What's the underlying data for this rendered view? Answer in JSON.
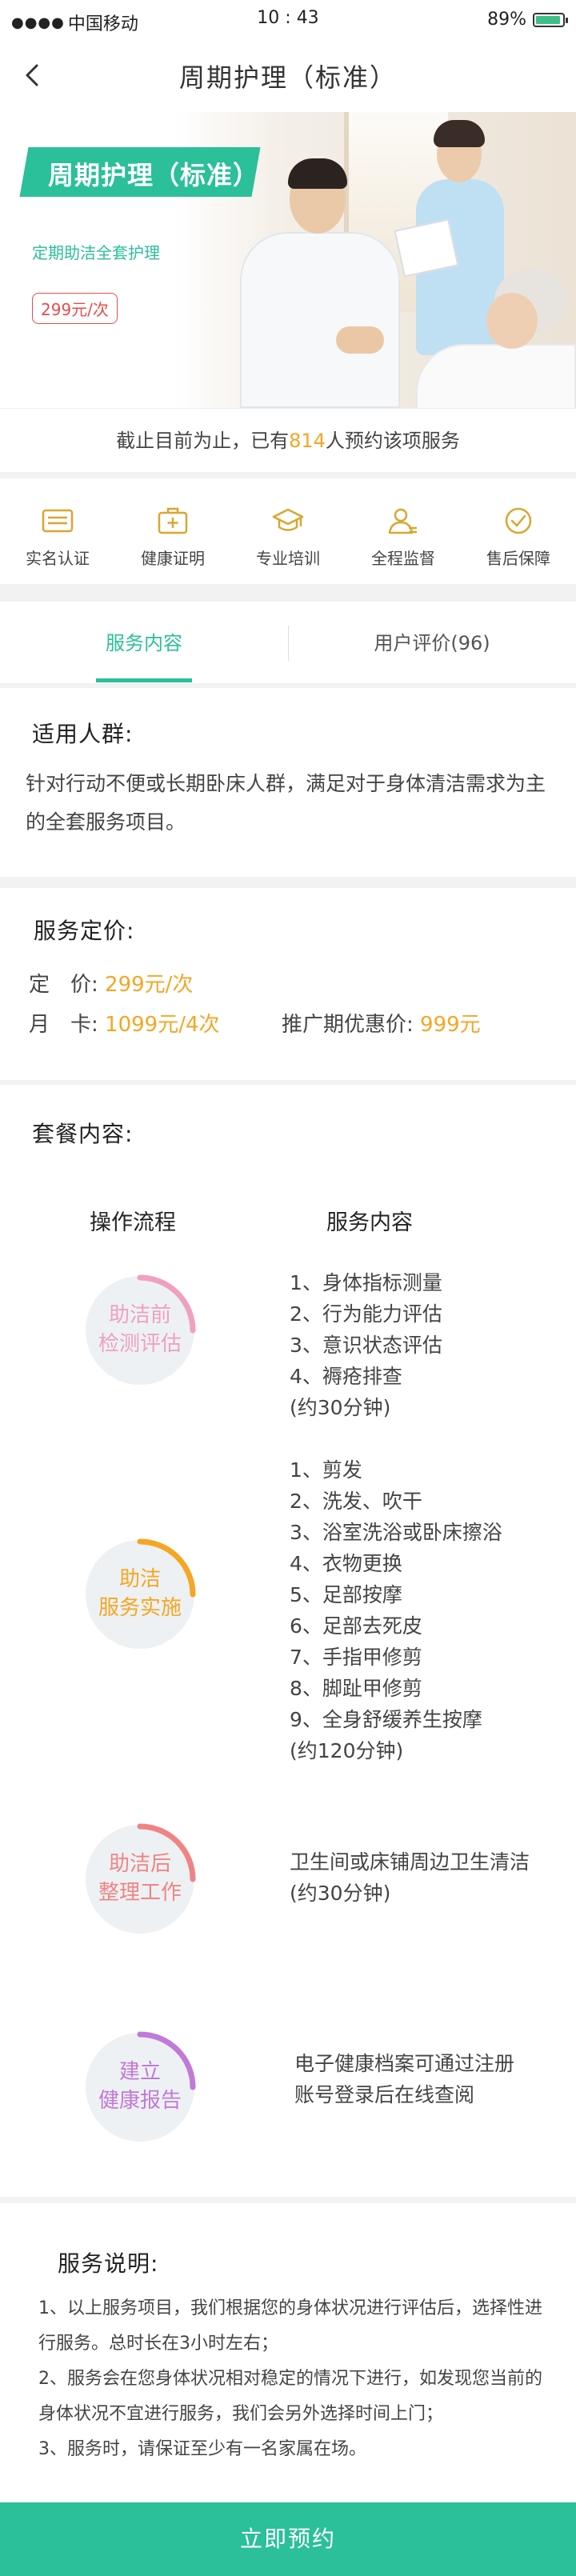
{
  "status_bar": {
    "carrier": "中国移动",
    "time": "10 : 43",
    "battery": "89%"
  },
  "nav": {
    "title": "周期护理（标准）"
  },
  "hero": {
    "tag": "周期护理（标准）",
    "subtitle": "定期助洁全套护理",
    "price": "299元/次"
  },
  "count": {
    "prefix": "截止目前为止，已有",
    "number": "814",
    "suffix": "人预约该项服务"
  },
  "features": [
    {
      "label": "实名认证",
      "icon": "id-card-icon"
    },
    {
      "label": "健康证明",
      "icon": "medical-kit-icon"
    },
    {
      "label": "专业培训",
      "icon": "graduation-cap-icon"
    },
    {
      "label": "全程监督",
      "icon": "user-supervise-icon"
    },
    {
      "label": "售后保障",
      "icon": "check-circle-icon"
    }
  ],
  "tabs": {
    "service": "服务内容",
    "reviews": "用户评价(96)"
  },
  "suitable": {
    "title": "适用人群:",
    "body": "针对行动不便或长期卧床人群，满足对于身体清洁需求为主的全套服务项目。"
  },
  "pricing": {
    "title": "服务定价:",
    "fixed_label": "定　价:",
    "fixed_value": "299元/次",
    "monthly_label": "月　卡:",
    "monthly_value": "1099元/4次",
    "promo_label": "推广期优惠价:",
    "promo_value": "999元"
  },
  "package": {
    "title": "套餐内容:",
    "col_process": "操作流程",
    "col_content": "服务内容",
    "steps": [
      {
        "label_l1": "助洁前",
        "label_l2": "检测评估",
        "color": "#f0a0c0",
        "progress": 0.25,
        "items": [
          "1、身体指标测量",
          "2、行为能力评估",
          "3、意识状态评估",
          "4、褥疮排查",
          "(约30分钟)"
        ]
      },
      {
        "label_l1": "助洁",
        "label_l2": "服务实施",
        "color": "#f5a623",
        "progress": 0.25,
        "items": [
          "1、剪发",
          "2、洗发、吹干",
          "3、浴室洗浴或卧床擦浴",
          "4、衣物更换",
          "5、足部按摩",
          "6、足部去死皮",
          "7、手指甲修剪",
          "8、脚趾甲修剪",
          "9、全身舒缓养生按摩",
          "(约120分钟)"
        ]
      },
      {
        "label_l1": "助洁后",
        "label_l2": "整理工作",
        "color": "#f08484",
        "progress": 0.25,
        "items": [
          "卫生间或床铺周边卫生清洁",
          "(约30分钟)"
        ]
      },
      {
        "label_l1": "建立",
        "label_l2": "健康报告",
        "color": "#c07ad8",
        "progress": 0.25,
        "items": [
          "电子健康档案可通过注册",
          "账号登录后在线查阅"
        ]
      }
    ]
  },
  "explanation": {
    "title": "服务说明:",
    "notes": [
      "1、以上服务项目，我们根据您的身体状况进行评估后，选择性进行服务。总时长在3小时左右；",
      "2、服务会在您身体状况相对稳定的情况下进行，如发现您当前的身体状况不宜进行服务，我们会另外选择时间上门；",
      "3、服务时，请保证至少有一名家属在场。"
    ]
  },
  "cta": {
    "label": "立即预约"
  },
  "colors": {
    "accent": "#2bbf9a",
    "price": "#f5a623",
    "tag_price": "#e94b4b"
  }
}
